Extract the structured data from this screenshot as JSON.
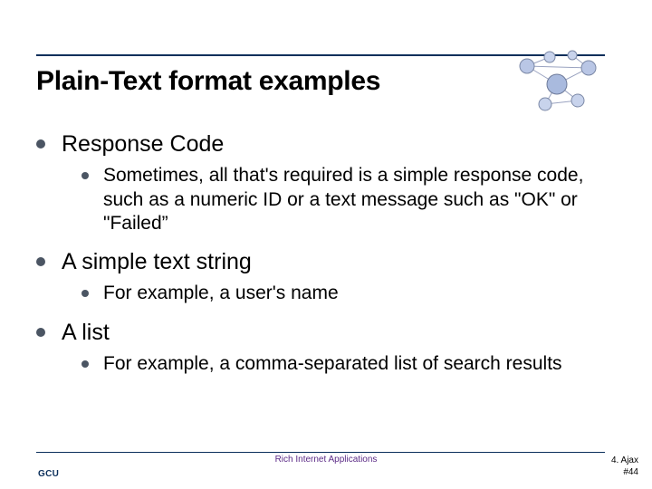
{
  "title": "Plain-Text format examples",
  "items": {
    "0": {
      "heading": "Response Code",
      "sub": "Sometimes, all that's required is a simple response code, such as a numeric ID or a text message such as \"OK\" or \"Failed”"
    },
    "1": {
      "heading": "A simple text string",
      "sub": "For example, a user's name"
    },
    "2": {
      "heading": "A list",
      "sub": "For example, a comma-separated list of search results"
    }
  },
  "footer": {
    "logo": "GCU",
    "center": "Rich Internet Applications",
    "right_line1": "4. Ajax",
    "right_line2": "#44"
  }
}
